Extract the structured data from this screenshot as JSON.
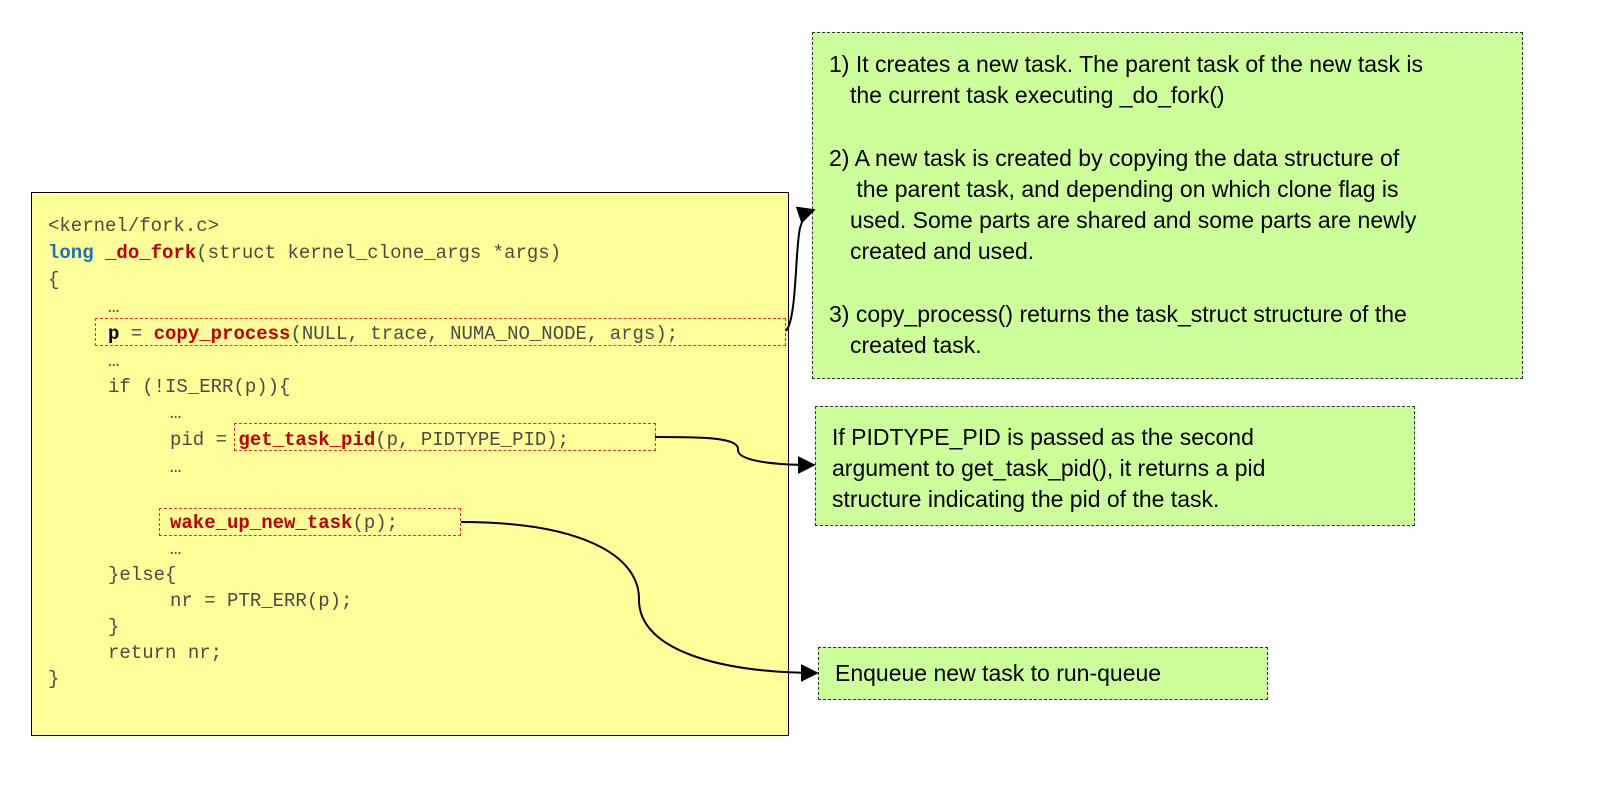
{
  "code": {
    "header": "<kernel/fork.c>",
    "signature": {
      "type": "long",
      "name": "_do_fork",
      "params": "(struct kernel_clone_args *args)"
    },
    "open_brace": "{",
    "ellipsis_1": "…",
    "copy_line": {
      "lhs": "p",
      "eq": " = ",
      "call": "copy_process",
      "args": "(NULL, trace, NUMA_NO_NODE, args);"
    },
    "ellipsis_2": "…",
    "if_line": "if (!IS_ERR(p)){",
    "ellipsis_3": "…",
    "pid_line": {
      "lhs": "pid = ",
      "call": "get_task_pid",
      "args": "(p, PIDTYPE_PID);"
    },
    "ellipsis_4": "…",
    "wake_line": {
      "call": "wake_up_new_task",
      "args": "(p);"
    },
    "ellipsis_5": "…",
    "else_line": "}else{",
    "nr_line": "nr = PTR_ERR(p);",
    "close_inner": "}",
    "return_line": "return nr;",
    "close_brace": "}"
  },
  "notes": {
    "copy_process": {
      "item1": {
        "line1": "1) It creates a new task. The parent task of the new task is",
        "line2": "the current task executing _do_fork()"
      },
      "item2": {
        "line1": "2) A new task is created by copying the data structure of",
        "line2": " the parent task, and depending on which clone flag is",
        "line3": "used. Some parts are shared and some parts are newly",
        "line4": "created and used."
      },
      "item3": {
        "line1": "3) copy_process() returns the task_struct structure of the",
        "line2": "created task."
      }
    },
    "get_task_pid": {
      "line1": "If PIDTYPE_PID is passed as the second",
      "line2": "argument to get_task_pid(), it returns a pid",
      "line3": "structure indicating the pid of the task."
    },
    "wake_up": {
      "line1": "Enqueue new task to run-queue"
    }
  },
  "colors": {
    "code_bg": "#ffff99",
    "note_bg": "#ccff99",
    "keyword": "#1f6fc0",
    "function": "#c00000",
    "highlight_border": "#e03030"
  }
}
